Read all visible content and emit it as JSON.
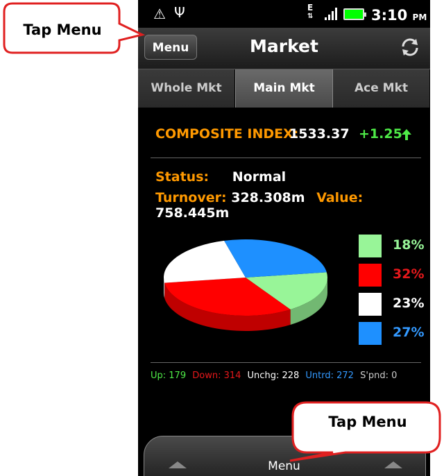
{
  "status_bar": {
    "time": "3:10",
    "ampm": "PM",
    "network": "E"
  },
  "header": {
    "menu_label": "Menu",
    "title": "Market"
  },
  "tabs": [
    {
      "label": "Whole Mkt"
    },
    {
      "label": "Main Mkt"
    },
    {
      "label": "Ace Mkt"
    }
  ],
  "composite": {
    "label": "COMPOSITE INDEX:",
    "value": "1533.37",
    "change": "+1.25"
  },
  "stats": {
    "status_label": "Status:",
    "status_value": "Normal",
    "turnover_label": "Turnover:",
    "turnover_value": "328.308m",
    "value_label": "Value:",
    "value_value": "758.445m"
  },
  "chart_data": {
    "type": "pie",
    "slices": [
      {
        "label": "18%",
        "value": 18,
        "color": "#98f598"
      },
      {
        "label": "32%",
        "value": 32,
        "color": "#ff0000"
      },
      {
        "label": "23%",
        "value": 23,
        "color": "#ffffff"
      },
      {
        "label": "27%",
        "value": 27,
        "color": "#1e90ff"
      }
    ]
  },
  "counts": {
    "up": "Up: 179",
    "down": "Down: 314",
    "unchg": "Unchg: 228",
    "untrd": "Untrd: 272",
    "spnd": "S'pnd: 0"
  },
  "bottom_bar": {
    "menu_label": "Menu"
  },
  "callouts": {
    "top": "Tap Menu",
    "bottom": "Tap Menu"
  },
  "colors": {
    "accent": "#ff9900",
    "up": "#4eea47",
    "down": "#e5181b",
    "untrd": "#3399ff"
  }
}
